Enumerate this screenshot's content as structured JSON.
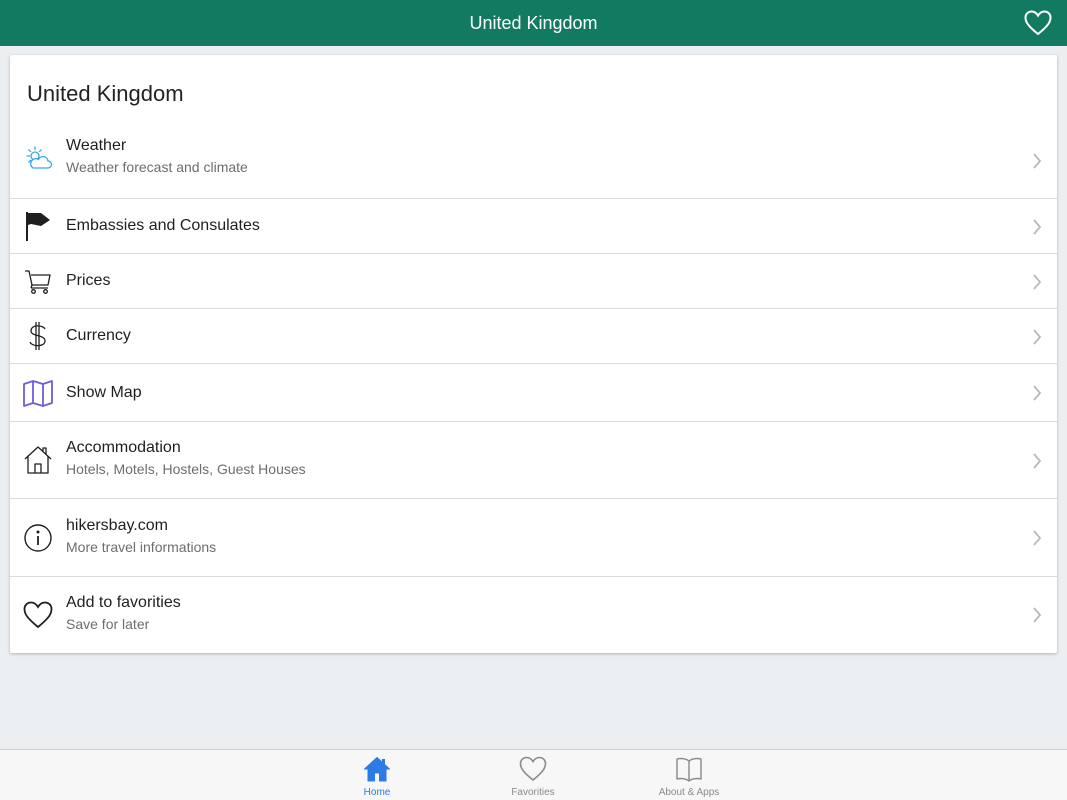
{
  "header": {
    "title": "United Kingdom",
    "background_color": "#137a62",
    "favorite_icon": "heart-outline-icon"
  },
  "card": {
    "title": "United Kingdom",
    "items": [
      {
        "label": "Weather",
        "subtitle": "Weather forecast and climate",
        "icon": "weather-icon",
        "icon_color": "#3aa8e0"
      },
      {
        "label": "Embassies and Consulates",
        "subtitle": "",
        "icon": "flag-icon"
      },
      {
        "label": "Prices",
        "subtitle": "",
        "icon": "cart-icon"
      },
      {
        "label": "Currency",
        "subtitle": "",
        "icon": "dollar-icon"
      },
      {
        "label": "Show Map",
        "subtitle": "",
        "icon": "map-icon",
        "icon_color": "#6b5fd6"
      },
      {
        "label": "Accommodation",
        "subtitle": "Hotels, Motels, Hostels, Guest Houses",
        "icon": "house-icon"
      },
      {
        "label": "hikersbay.com",
        "subtitle": "More travel informations",
        "icon": "info-icon"
      },
      {
        "label": "Add to favorities",
        "subtitle": "Save for later",
        "icon": "heart-icon"
      }
    ]
  },
  "tabbar": {
    "active_color": "#2d7be5",
    "tabs": [
      {
        "label": "Home",
        "icon": "home-icon",
        "active": true
      },
      {
        "label": "Favorities",
        "icon": "heart-outline-icon",
        "active": false
      },
      {
        "label": "About & Apps",
        "icon": "book-icon",
        "active": false
      }
    ]
  }
}
